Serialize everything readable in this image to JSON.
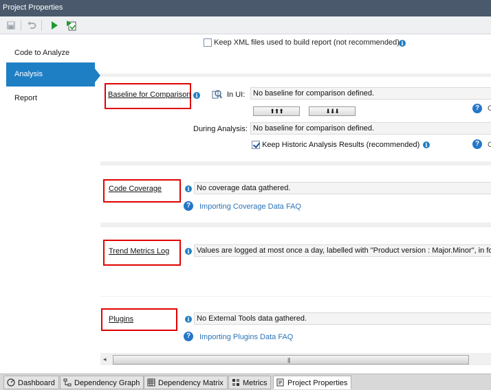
{
  "window": {
    "title": "Project Properties"
  },
  "toolbar": {
    "save_icon": "save-icon",
    "undo_icon": "undo-icon",
    "run_icon": "run-analysis-icon",
    "run_report_icon": "run-report-icon"
  },
  "sidebar": {
    "items": [
      {
        "label": "Code to Analyze"
      },
      {
        "label": "Analysis"
      },
      {
        "label": "Report"
      }
    ],
    "active_color": "#1f7fc4"
  },
  "content": {
    "xml_option": {
      "label": "Keep XML files used to build report (not recommended)",
      "checked": false
    },
    "baseline": {
      "title": "Baseline for Comparison",
      "in_ui_label": "In UI:",
      "in_ui_value": "No baseline for comparison defined.",
      "up_button": "⬆⬆⬆",
      "down_button": "⬇⬇⬇",
      "during_analysis_label": "During Analysis:",
      "during_analysis_value": "No baseline for comparison defined.",
      "keep_historic_label": "Keep Historic Analysis Results (recommended)",
      "keep_historic_checked": true,
      "cut_text_1": "C",
      "cut_text_2": "C"
    },
    "code_coverage": {
      "title": "Code Coverage",
      "value": "No coverage data gathered.",
      "faq_link": "Importing Coverage Data FAQ"
    },
    "trend_metrics": {
      "title": "Trend Metrics Log",
      "value": "Values are logged at most once a day, labelled with \"Product version : Major.Minor\", in fol"
    },
    "plugins": {
      "title": "Plugins",
      "value": "No External Tools data gathered.",
      "faq_link": "Importing Plugins Data FAQ"
    },
    "highlight_color": "#e00000"
  },
  "scrollbar": {
    "grip": "|||"
  },
  "tabs": [
    {
      "label": "Dashboard",
      "icon": "dashboard-icon"
    },
    {
      "label": "Dependency Graph",
      "icon": "dependency-graph-icon"
    },
    {
      "label": "Dependency Matrix",
      "icon": "dependency-matrix-icon"
    },
    {
      "label": "Metrics",
      "icon": "metrics-icon"
    },
    {
      "label": "Project Properties",
      "icon": "project-properties-icon",
      "active": true
    }
  ]
}
